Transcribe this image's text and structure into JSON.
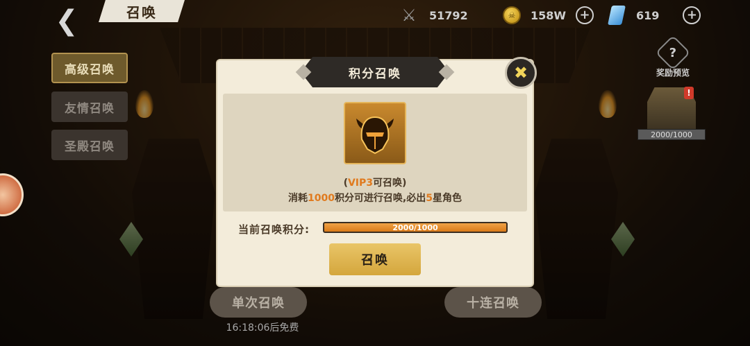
{
  "header": {
    "back_icon": "back-arrow-icon",
    "title": "召唤"
  },
  "resources": {
    "power": {
      "icon": "crossed-swords-icon",
      "value": "51792"
    },
    "gold": {
      "icon": "coin-icon",
      "value": "158W"
    },
    "gems": {
      "icon": "gem-icon",
      "value": "619"
    }
  },
  "side_tabs": [
    {
      "label": "高级召唤",
      "active": true
    },
    {
      "label": "友情召唤",
      "active": false
    },
    {
      "label": "圣殿召唤",
      "active": false
    }
  ],
  "right_panel": {
    "reward_preview_label": "奖励预览",
    "chest_progress": "2000/1000"
  },
  "bottom": {
    "single_summon": "单次召唤",
    "ten_summon": "十连召唤",
    "free_timer": "16:18:06后免费"
  },
  "modal": {
    "title": "积分召唤",
    "vip_open": "(",
    "vip_level": "VIP3",
    "vip_close": "可召唤)",
    "cost_prefix": "消耗",
    "cost_points": "1000",
    "cost_mid": "积分可进行召唤,必出",
    "cost_stars": "5",
    "cost_suffix": "星角色",
    "points_label": "当前召唤积分:",
    "points_text": "2000/1000",
    "points_fill_fraction": 1.0,
    "summon_button": "召唤"
  },
  "colors": {
    "accent_orange": "#e07a1e",
    "button_gold": "#d4a63c"
  }
}
